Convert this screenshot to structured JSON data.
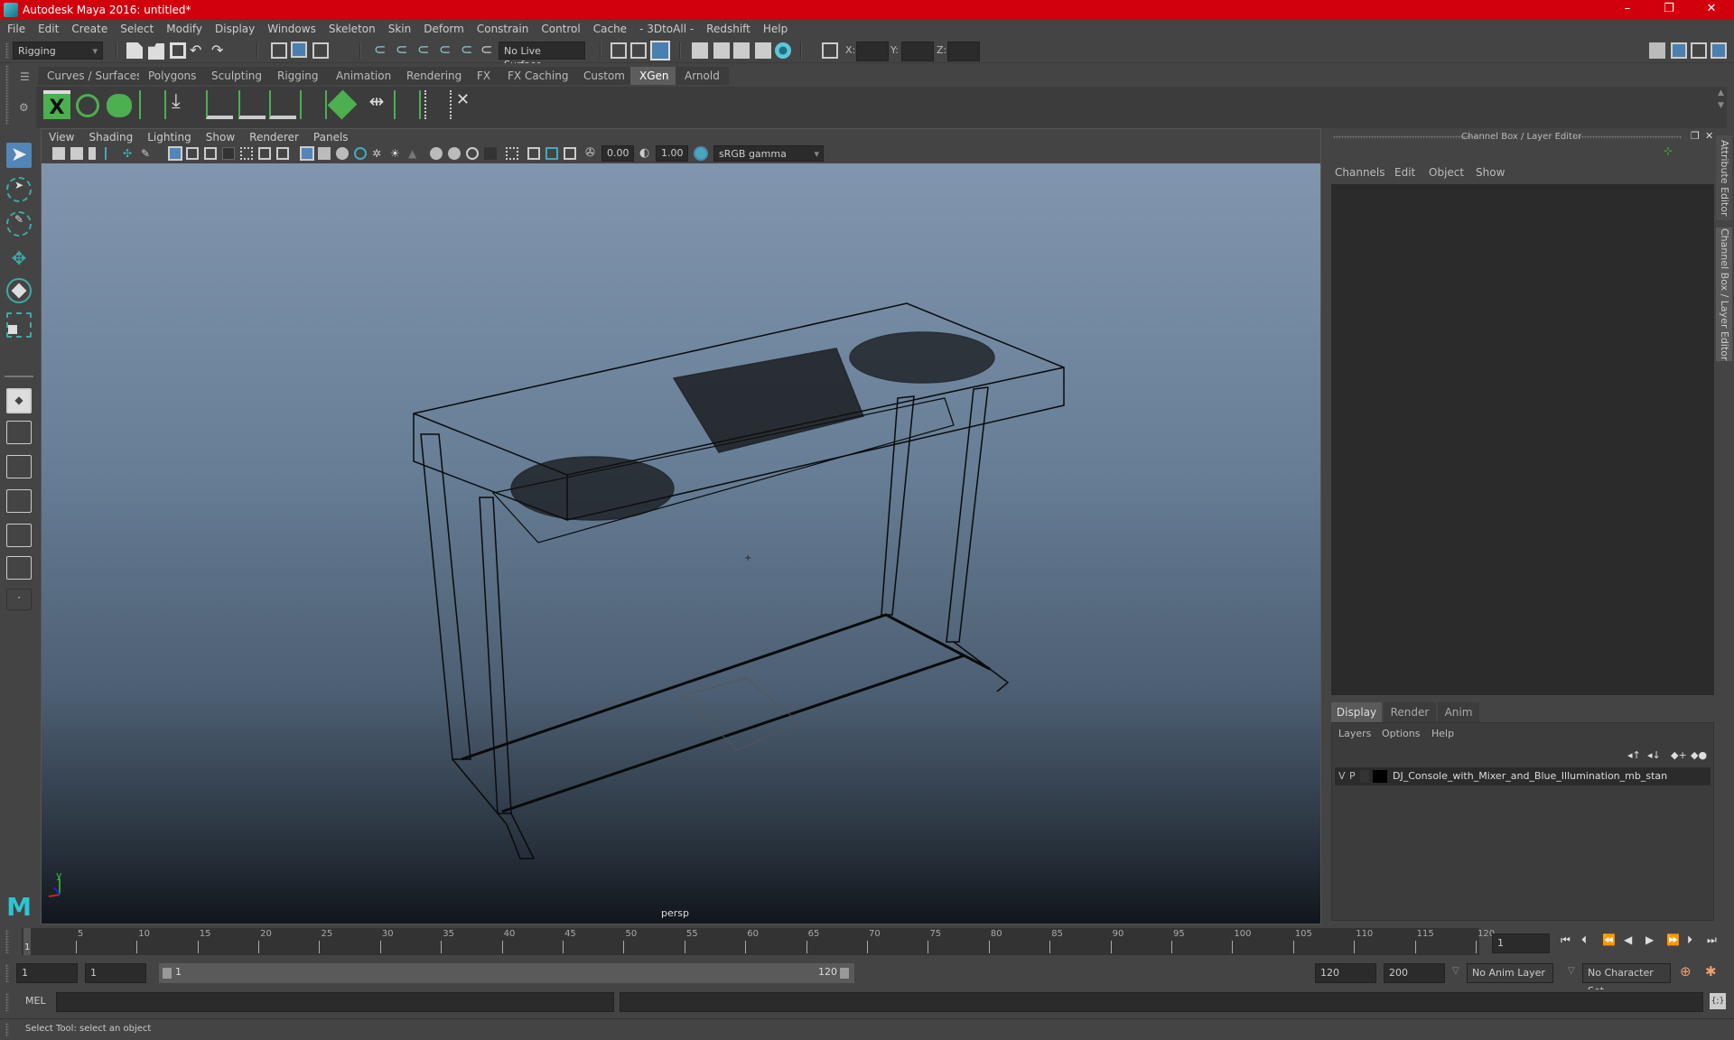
{
  "window": {
    "title": "Autodesk Maya 2016: untitled*",
    "controls": {
      "minimize": "–",
      "restore": "❐",
      "close": "✕"
    }
  },
  "menubar": [
    "File",
    "Edit",
    "Create",
    "Select",
    "Modify",
    "Display",
    "Windows",
    "Skeleton",
    "Skin",
    "Deform",
    "Constrain",
    "Control",
    "Cache",
    "- 3DtoAll -",
    "Redshift",
    "Help"
  ],
  "statusline": {
    "menuset": "Rigging",
    "live_surface": "No Live Surface",
    "xyz_labels": [
      "X:",
      "Y:",
      "Z:"
    ],
    "xyz_values": [
      "",
      "",
      ""
    ]
  },
  "shelf": {
    "tabs": [
      "Curves / Surfaces",
      "Polygons",
      "Sculpting",
      "Rigging",
      "Animation",
      "Rendering",
      "FX",
      "FX Caching",
      "Custom",
      "XGen",
      "Arnold"
    ],
    "active_tab": "XGen",
    "icons": [
      "xgen-window-icon",
      "xgen-preview-icon",
      "xgen-clear-preview-icon",
      "xgen-add-guides-icon",
      "xgen-place-guide-icon",
      "xgen-add-guide-icon",
      "xgen-sculpt-guide-icon",
      "xgen-lock-guide-icon",
      "xgen-bend-guide-icon",
      "xgen-layer-icon",
      "xgen-scale-guide-icon",
      "xgen-select-guide-icon",
      "xgen-flip-guide-icon",
      "xgen-delete-guide-icon"
    ]
  },
  "viewport": {
    "menu": [
      "View",
      "Shading",
      "Lighting",
      "Show",
      "Renderer",
      "Panels"
    ],
    "exposure": "0.00",
    "gamma": "1.00",
    "color_space": "sRGB gamma",
    "camera_label": "persp",
    "axis": {
      "y": "y"
    }
  },
  "right_panel": {
    "header": "Channel Box / Layer Editor",
    "channel_menu": [
      "Channels",
      "Edit",
      "Object",
      "Show"
    ],
    "layer_tabs": [
      "Display",
      "Render",
      "Anim"
    ],
    "active_layer_tab": "Display",
    "layer_menu": [
      "Layers",
      "Options",
      "Help"
    ],
    "layers": [
      {
        "v": "V",
        "p": "P",
        "name": "DJ_Console_with_Mixer_and_Blue_Illumination_mb_stan",
        "color": "#000000"
      }
    ],
    "side_tabs": [
      "Attribute Editor",
      "Channel Box / Layer Editor"
    ]
  },
  "timeline": {
    "ticks": [
      5,
      10,
      15,
      20,
      25,
      30,
      35,
      40,
      45,
      50,
      55,
      60,
      65,
      70,
      75,
      80,
      85,
      90,
      95,
      100,
      105,
      110,
      115,
      120
    ],
    "current_frame_label": "1",
    "current_frame": "1",
    "playback_buttons": [
      "go-to-start",
      "step-back-key",
      "step-back-frame",
      "play-back",
      "play-forward",
      "step-forward-frame",
      "step-forward-key",
      "go-to-end"
    ]
  },
  "range": {
    "start": "1",
    "playback_start": "1",
    "slider_start": "1",
    "slider_end": "120",
    "playback_end": "120",
    "end": "200",
    "anim_layer": "No Anim Layer",
    "character_set": "No Character Set"
  },
  "command": {
    "label": "MEL",
    "value": ""
  },
  "help_line": "Select Tool: select an object"
}
